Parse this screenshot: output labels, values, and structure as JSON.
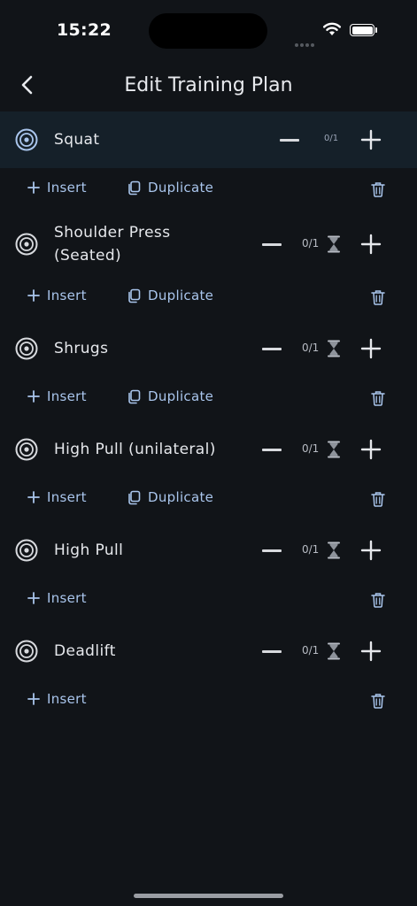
{
  "status_bar": {
    "time": "15:22"
  },
  "header": {
    "title": "Edit Training Plan",
    "back_icon": "chevron-left-icon"
  },
  "actions": {
    "insert_label": "Insert",
    "duplicate_label": "Duplicate"
  },
  "colors": {
    "background": "#111418",
    "selected_row": "#152029",
    "accent": "#a9c5ec"
  },
  "exercises": [
    {
      "name": "Squat",
      "count": "0/1",
      "selected": true,
      "has_timer": false,
      "duplicate": true
    },
    {
      "name": "Shoulder Press",
      "name_line2": "(Seated)",
      "count": "0/1",
      "has_timer": true,
      "duplicate": true
    },
    {
      "name": "Shrugs",
      "count": "0/1",
      "has_timer": true,
      "duplicate": true
    },
    {
      "name": "High Pull (unilateral)",
      "count": "0/1",
      "has_timer": true,
      "duplicate": true
    },
    {
      "name": "High Pull",
      "count": "0/1",
      "has_timer": true,
      "duplicate": false
    },
    {
      "name": "Deadlift",
      "count": "0/1",
      "has_timer": true,
      "duplicate": false
    }
  ]
}
